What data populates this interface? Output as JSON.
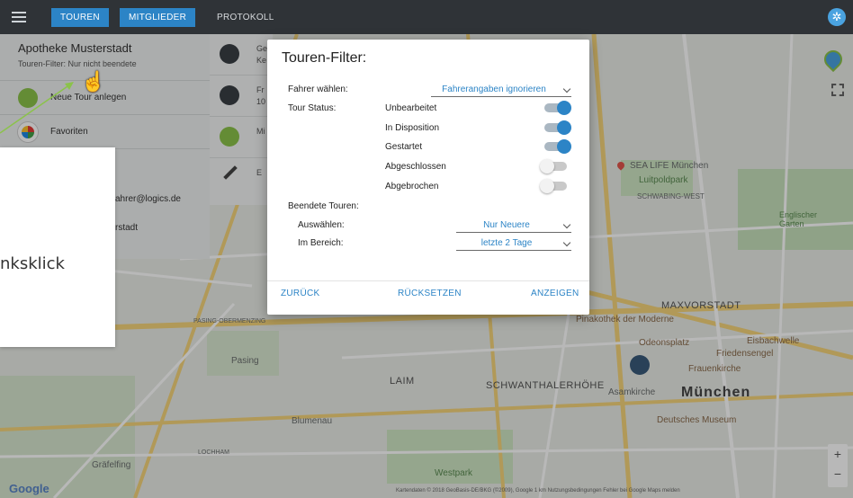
{
  "topbar": {
    "tabs": [
      {
        "label": "TOUREN",
        "active": true
      },
      {
        "label": "MITGLIEDER",
        "active": true
      },
      {
        "label": "PROTOKOLL",
        "active": false
      }
    ]
  },
  "left_panel": {
    "title": "Apotheke Musterstadt",
    "subtitle": "Touren-Filter: Nur nicht beendete",
    "items": [
      {
        "label": "Neue Tour anlegen"
      },
      {
        "label": "Favoriten"
      }
    ],
    "email_fragment": "ahrer@logics.de",
    "city_fragment": "rstadt"
  },
  "middle_panel": {
    "rows": [
      {
        "text": "Ge Ke"
      },
      {
        "text": "Fr 10"
      },
      {
        "text": "Mi"
      },
      {
        "text": "E"
      }
    ]
  },
  "tooltip": {
    "text": "nksklick"
  },
  "modal": {
    "title": "Touren-Filter:",
    "driver_label": "Fahrer wählen:",
    "driver_value": "Fahrerangaben ignorieren",
    "status_label": "Tour Status:",
    "statuses": [
      {
        "label": "Unbearbeitet",
        "on": true
      },
      {
        "label": "In Disposition",
        "on": true
      },
      {
        "label": "Gestartet",
        "on": true
      },
      {
        "label": "Abgeschlossen",
        "on": false
      },
      {
        "label": "Abgebrochen",
        "on": false
      }
    ],
    "finished_label": "Beendete Touren:",
    "select_label": "Auswählen:",
    "select_value": "Nur Neuere",
    "range_label": "Im Bereich:",
    "range_value": "letzte 2 Tage",
    "buttons": {
      "back": "ZURÜCK",
      "reset": "RÜCKSETZEN",
      "show": "ANZEIGEN"
    }
  },
  "map": {
    "labels": {
      "muenchen": "München",
      "maxvorstadt": "MAXVORSTADT",
      "schwanthalerhoehe": "SCHWANTHALERHÖHE",
      "laim": "LAIM",
      "sealife": "SEA LIFE München",
      "luitpoldpark": "Luitpoldpark",
      "schwabing": "SCHWABING-WEST",
      "englischer_garten": "Englischer Garten",
      "pinakothek": "Pinakothek der Moderne",
      "odeonsplatz": "Odeonsplatz",
      "eisbachwelle": "Eisbachwelle",
      "friedensengel": "Friedensengel",
      "frauenkirche": "Frauenkirche",
      "asamkirche": "Asamkirche",
      "deutsches_museum": "Deutsches Museum",
      "pasing": "Pasing",
      "pasing_obermenzing": "PASING-OBERMENZING",
      "blumenau": "Blumenau",
      "graefelfing": "Gräfelfing",
      "westpark": "Westpark",
      "lochham": "LOCHHAM"
    },
    "google": "Google",
    "attribution": "Kartendaten © 2018 GeoBasis-DE/BKG (©2009), Google   1 km   Nutzungsbedingungen   Fehler bei Google Maps melden"
  },
  "colors": {
    "accent": "#2c84c6",
    "topbar": "#2f3337",
    "toggle_on": "#2c84c6"
  }
}
